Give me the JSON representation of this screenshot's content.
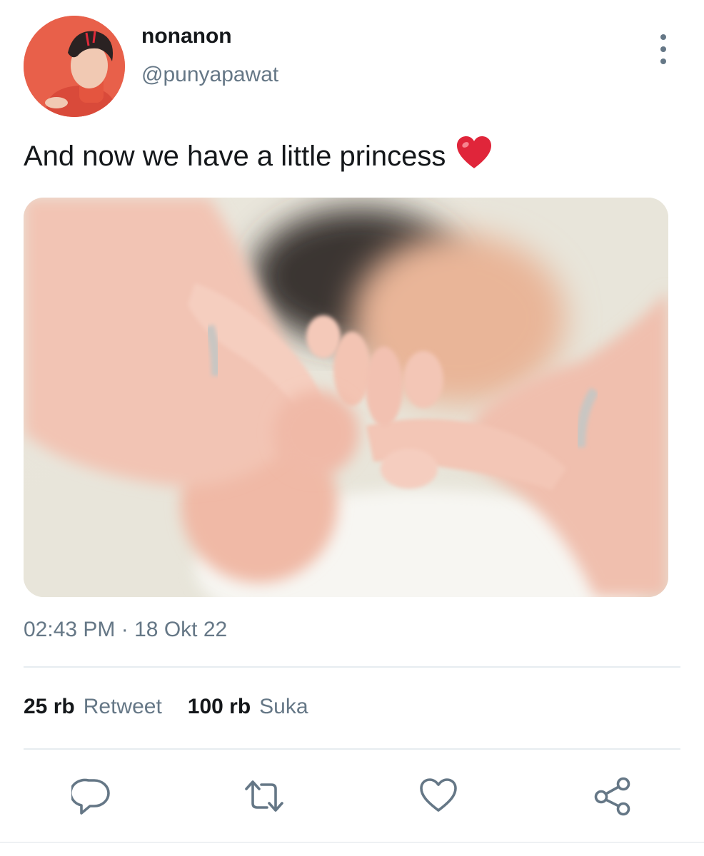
{
  "tweet": {
    "display_name": "nonanon",
    "handle": "@punyapawat",
    "text": "And now we have a little princess",
    "emoji": "heart",
    "time": "02:43 PM",
    "separator": "·",
    "date": "18 Okt 22"
  },
  "stats": {
    "retweet_count": "25 rb",
    "retweet_label": "Retweet",
    "like_count": "100 rb",
    "like_label": "Suka"
  },
  "actions": {
    "reply_icon": "reply-icon",
    "retweet_icon": "retweet-icon",
    "like_icon": "heart-icon",
    "share_icon": "share-icon"
  },
  "colors": {
    "text_primary": "#14171a",
    "text_secondary": "#657786",
    "divider": "#e6ecf0",
    "heart_red": "#e0253a"
  }
}
